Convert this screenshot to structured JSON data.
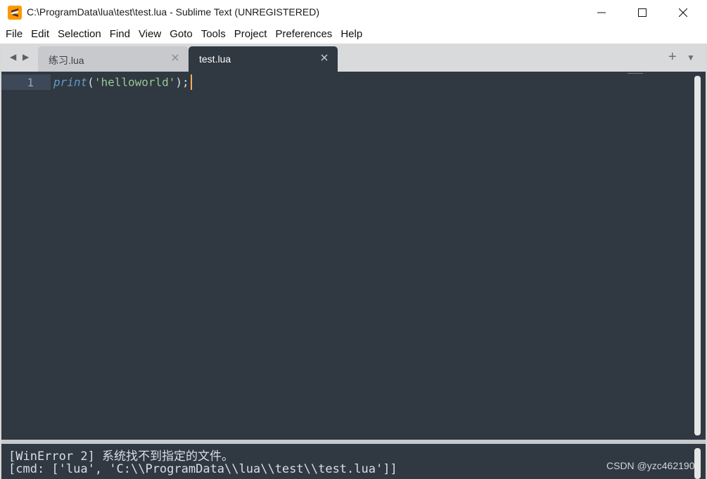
{
  "window": {
    "title": "C:\\ProgramData\\lua\\test\\test.lua - Sublime Text (UNREGISTERED)",
    "icon": "sublime-logo-icon",
    "controls": [
      "minimize-icon",
      "maximize-icon",
      "close-icon"
    ]
  },
  "menu": {
    "items": [
      "File",
      "Edit",
      "Selection",
      "Find",
      "View",
      "Goto",
      "Tools",
      "Project",
      "Preferences",
      "Help"
    ]
  },
  "tabs": [
    {
      "label": "练习.lua",
      "active": false
    },
    {
      "label": "test.lua",
      "active": true
    }
  ],
  "editor": {
    "line_numbers": [
      "1"
    ],
    "code": {
      "func": "print",
      "open": "(",
      "string": "'helloworld'",
      "close": ");"
    }
  },
  "output": {
    "lines": [
      "[WinError 2] 系统找不到指定的文件。",
      "[cmd: ['lua', 'C:\\\\ProgramData\\\\lua\\\\test\\\\test.lua']]"
    ]
  },
  "watermark": "CSDN @yzc462190",
  "colors": {
    "editor_bg": "#303841",
    "function": "#6699cc",
    "string": "#99c794",
    "cursor": "#f9ae58",
    "app_icon": "#ff9800"
  }
}
